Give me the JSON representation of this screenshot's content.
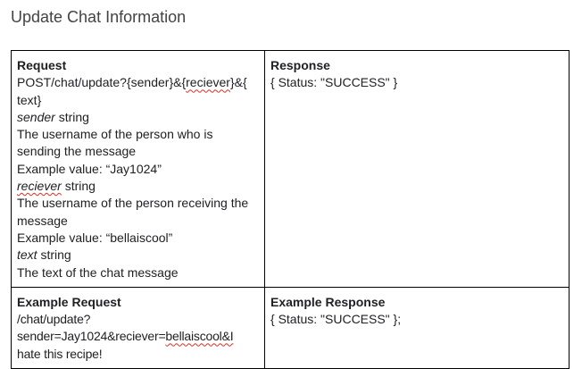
{
  "page_title": "Update Chat Information",
  "request": {
    "heading": "Request",
    "endpoint_part1": "POST/chat/update?{sender}&{",
    "endpoint_reciever": "reciever",
    "endpoint_part2": "}&{",
    "endpoint_part3": "text}",
    "params": [
      {
        "name": "sender",
        "type": "string",
        "description": "The username of the person who is sending the message",
        "example": "Example value: “Jay1024”"
      },
      {
        "name": "reciever",
        "type": "string",
        "description": "The username of the person receiving the message",
        "example": "Example value: “bellaiscool”"
      },
      {
        "name": "text",
        "type": "string",
        "description": "The text of the chat message"
      }
    ]
  },
  "response": {
    "heading": "Response",
    "body": "{ Status: \"SUCCESS\" }"
  },
  "example_request": {
    "heading": "Example Request",
    "part1": "/chat/update?sender=Jay1024&reciever=",
    "part2_squiggle": "bellaiscool&I",
    "part3": " hate this recipe!"
  },
  "example_response": {
    "heading": "Example Response",
    "body": "{ Status: \"SUCCESS\" };"
  }
}
